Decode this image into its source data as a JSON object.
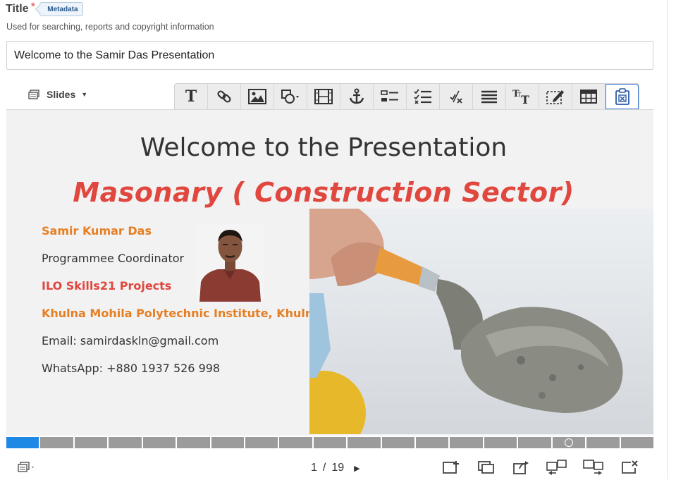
{
  "field": {
    "title_label": "Title",
    "required_mark": "*",
    "metadata_badge": "Metadata",
    "hint": "Used for searching, reports and copyright information",
    "title_value": "Welcome to the Samir Das Presentation"
  },
  "editor": {
    "slides_menu_label": "Slides",
    "toolbar_buttons": [
      "text",
      "link",
      "image",
      "shapes",
      "video",
      "anchor",
      "single-choice",
      "multiple-choice",
      "fill-blanks",
      "list",
      "text-style",
      "annotation",
      "table",
      "paste"
    ]
  },
  "slide": {
    "title": "Welcome to the Presentation",
    "subtitle": "Masonary ( Construction Sector)",
    "name": "Samir Kumar Das",
    "role": "Programmee Coordinator",
    "project": "ILO Skills21 Projects",
    "institute": "Khulna Mohila Polytechnic Institute, Khulna",
    "email": "Email: samirdaskln@gmail.com",
    "whatsapp": "WhatsApp: +880 1937 526 998"
  },
  "navigation": {
    "current_page": "1",
    "separator": "/",
    "total_pages": "19",
    "total_segments": 19,
    "active_segment": 1,
    "marked_segment": 17
  },
  "colors": {
    "accent_blue": "#1e88e5",
    "title_red": "#e0473e",
    "name_orange": "#e67e22"
  }
}
